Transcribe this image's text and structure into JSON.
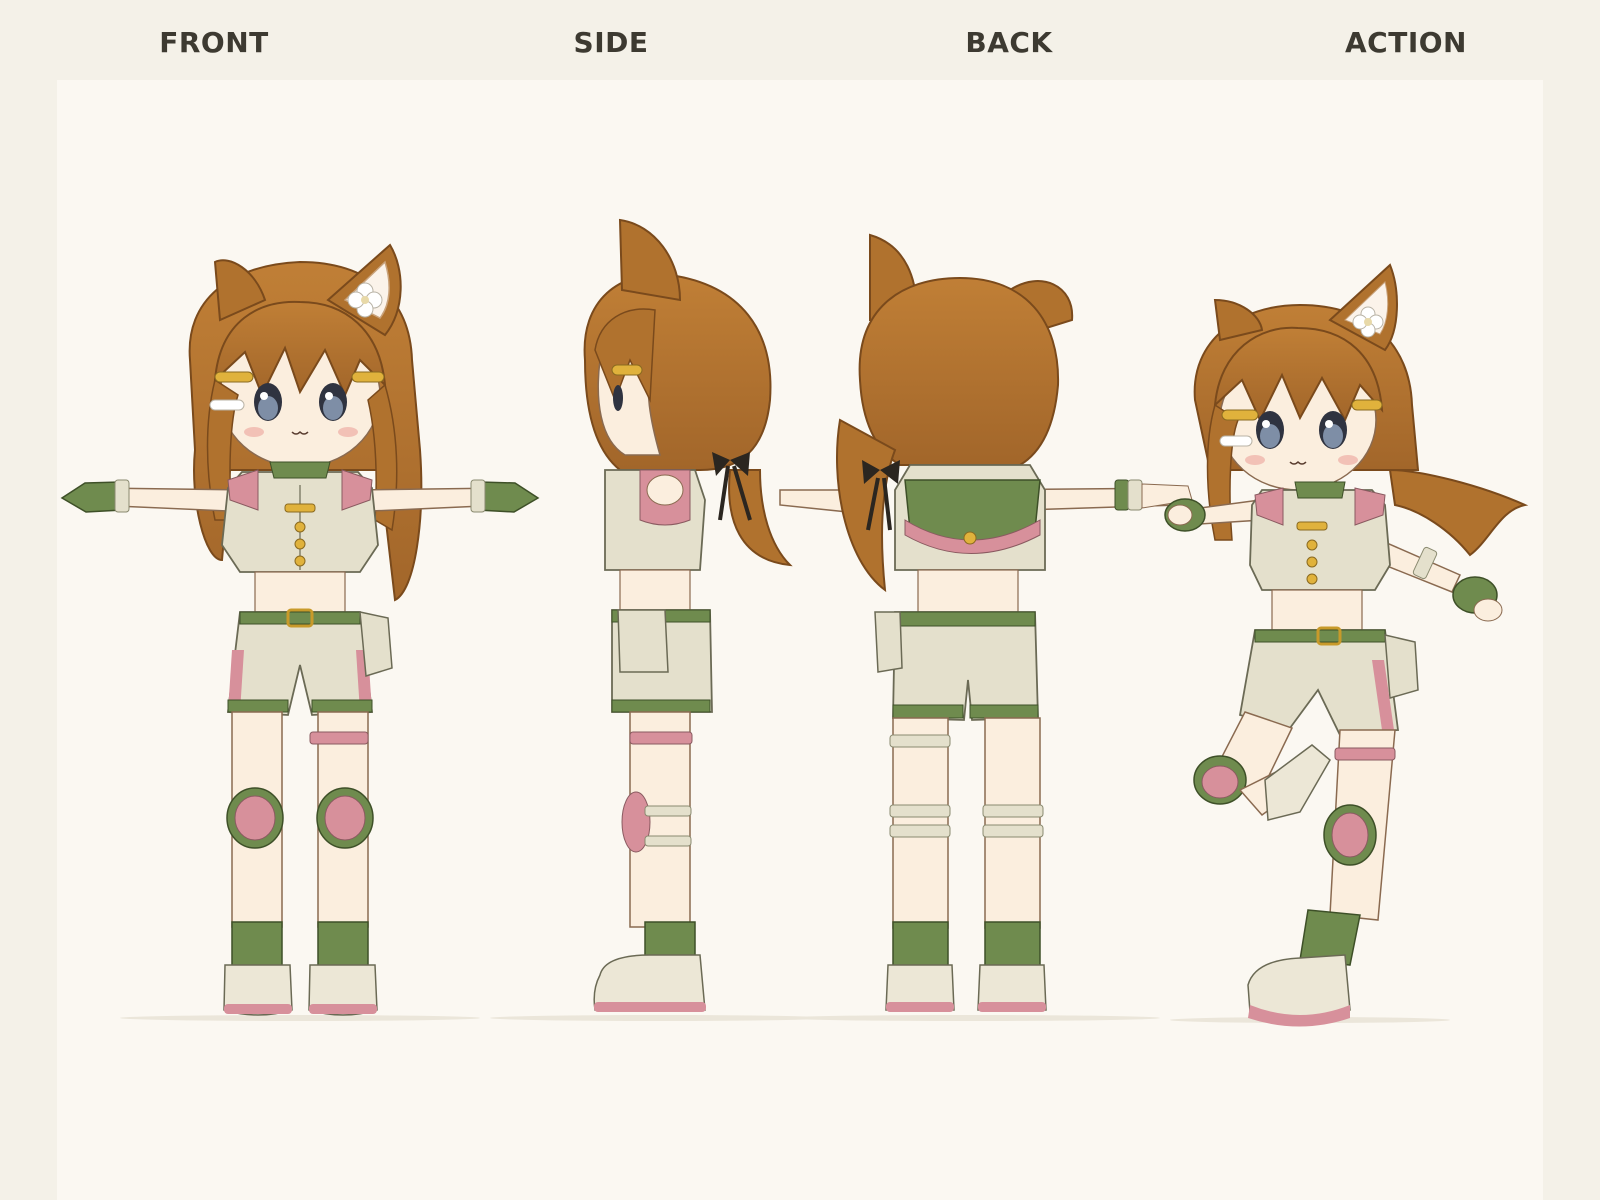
{
  "sheet": {
    "views": [
      {
        "id": "front",
        "label": "FRONT"
      },
      {
        "id": "side",
        "label": "SIDE"
      },
      {
        "id": "back",
        "label": "BACK"
      },
      {
        "id": "action",
        "label": "ACTION"
      }
    ]
  },
  "character": {
    "hair_color": "#b0722e",
    "hair_dark": "#8a5420",
    "skin_color": "#fbeede",
    "top_color": "#e4e0cc",
    "accent_green": "#6f8b4e",
    "accent_pink": "#d7909b",
    "button_yellow": "#e0b23c",
    "eye_color": "#3f4a5a",
    "ribbon_color": "#2b2620",
    "icons": [
      "cat-ears",
      "flower-hair-ornament",
      "hair-clip",
      "knee-pad",
      "waist-pouch",
      "fingerless-glove",
      "sneaker"
    ]
  }
}
